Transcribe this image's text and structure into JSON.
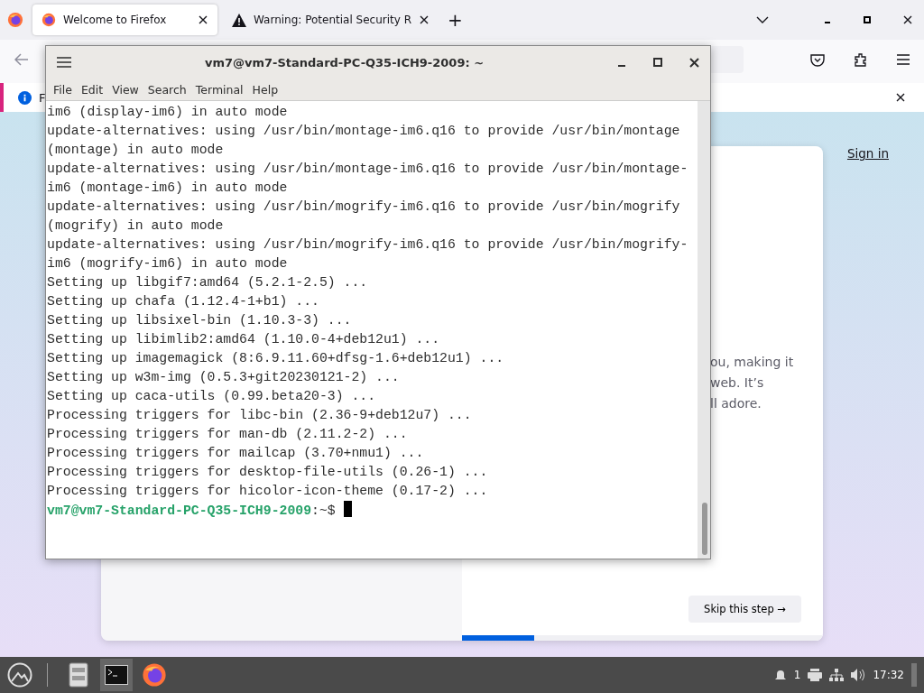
{
  "browser": {
    "tabs": [
      {
        "title": "Welcome to Firefox",
        "kind": "firefox",
        "selected": true
      },
      {
        "title": "Warning: Potential Security R",
        "kind": "warning",
        "selected": false
      }
    ],
    "new_tab": "+",
    "notification": {
      "text": "F"
    },
    "page": {
      "sign_in": "Sign in",
      "body_lines": [
        "ou, making it",
        "web. It’s",
        "ll adore."
      ],
      "skip_button": "Skip this step →",
      "progress": {
        "level": 0.2
      }
    }
  },
  "terminal": {
    "title": "vm7@vm7-Standard-PC-Q35-ICH9-2009: ~",
    "menu": [
      "File",
      "Edit",
      "View",
      "Search",
      "Terminal",
      "Help"
    ],
    "lines": [
      "im6 (display-im6) in auto mode",
      "update-alternatives: using /usr/bin/montage-im6.q16 to provide /usr/bin/montage",
      "(montage) in auto mode",
      "update-alternatives: using /usr/bin/montage-im6.q16 to provide /usr/bin/montage-",
      "im6 (montage-im6) in auto mode",
      "update-alternatives: using /usr/bin/mogrify-im6.q16 to provide /usr/bin/mogrify",
      "(mogrify) in auto mode",
      "update-alternatives: using /usr/bin/mogrify-im6.q16 to provide /usr/bin/mogrify-",
      "im6 (mogrify-im6) in auto mode",
      "Setting up libgif7:amd64 (5.2.1-2.5) ...",
      "Setting up chafa (1.12.4-1+b1) ...",
      "Setting up libsixel-bin (1.10.3-3) ...",
      "Setting up libimlib2:amd64 (1.10.0-4+deb12u1) ...",
      "Setting up imagemagick (8:6.9.11.60+dfsg-1.6+deb12u1) ...",
      "Setting up w3m-img (0.5.3+git20230121-2) ...",
      "Setting up caca-utils (0.99.beta20-3) ...",
      "Processing triggers for libc-bin (2.36-9+deb12u7) ...",
      "Processing triggers for man-db (2.11.2-2) ...",
      "Processing triggers for mailcap (3.70+nmu1) ...",
      "Processing triggers for desktop-file-utils (0.26-1) ...",
      "Processing triggers for hicolor-icon-theme (0.17-2) ..."
    ],
    "prompt": {
      "user_host": "vm7@vm7-Standard-PC-Q35-ICH9-2009",
      "suffix": ":~$"
    }
  },
  "taskbar": {
    "apps": [
      {
        "kind": "files",
        "selected": false
      },
      {
        "kind": "terminal",
        "selected": true
      },
      {
        "kind": "firefox",
        "selected": false
      }
    ],
    "notifications": "1",
    "clock": "17:32"
  }
}
